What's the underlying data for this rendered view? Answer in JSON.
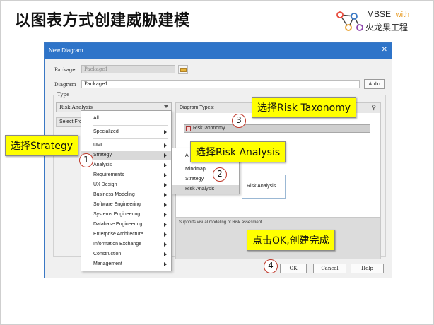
{
  "slide": {
    "title": "以图表方式创建威胁建模"
  },
  "logo": {
    "name": "MBSE",
    "accent": "with",
    "subtitle": "火龙果工程",
    "accent_color": "#e89b22"
  },
  "dialog": {
    "title": "New Diagram",
    "package_label": "Package",
    "package_value": "Package1",
    "diagram_label": "Diagram",
    "diagram_value": "Package1",
    "auto_button": "Auto",
    "type_label": "Type",
    "type_combo_value": "Risk Analysis",
    "select_from": "Select From",
    "diagram_types_header": "Diagram Types:",
    "selected_diagram_type": "RiskTaxonomy",
    "preview_label": "Risk Analysis",
    "description": "Supports visual modeling of Risk assesment.",
    "ok_button": "OK",
    "cancel_button": "Cancel",
    "help_button": "Help"
  },
  "menu": {
    "items": [
      {
        "label": "All",
        "arrow": false
      },
      {
        "label": "Specialized",
        "arrow": true
      },
      {
        "label": "UML",
        "arrow": true
      },
      {
        "label": "Strategy",
        "arrow": true,
        "highlighted": true
      },
      {
        "label": "Analysis",
        "arrow": true
      },
      {
        "label": "Requirements",
        "arrow": true
      },
      {
        "label": "UX Design",
        "arrow": true
      },
      {
        "label": "Business Modeling",
        "arrow": true
      },
      {
        "label": "Software Engineering",
        "arrow": true
      },
      {
        "label": "Systems Engineering",
        "arrow": true
      },
      {
        "label": "Database Engineering",
        "arrow": true
      },
      {
        "label": "Enterprise Architecture",
        "arrow": true
      },
      {
        "label": "Information Exchange",
        "arrow": true
      },
      {
        "label": "Construction",
        "arrow": true
      },
      {
        "label": "Management",
        "arrow": true
      }
    ]
  },
  "submenu": {
    "items": [
      {
        "label": "A"
      },
      {
        "label": "Mindmap"
      },
      {
        "label": "Strategy"
      },
      {
        "label": "Risk Analysis",
        "highlighted": true
      }
    ]
  },
  "callouts": {
    "strategy": "选择Strategy",
    "risk_analysis": "选择Risk Analysis",
    "risk_taxonomy": "选择Risk Taxonomy",
    "ok": "点击OK,创建完成"
  },
  "steps": [
    "1",
    "2",
    "3",
    "4"
  ],
  "colors": {
    "titlebar": "#2e74c9",
    "callout": "#ffff00",
    "step_ring": "#c0392b"
  }
}
